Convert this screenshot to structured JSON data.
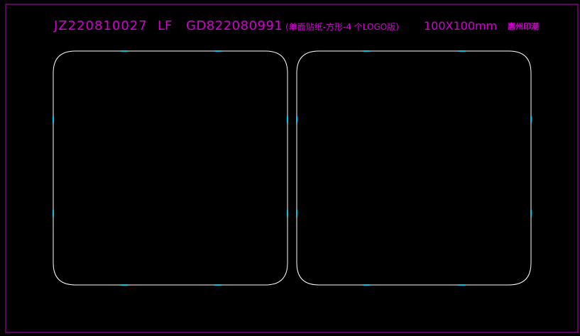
{
  "title": {
    "job_code": "JZ220810027",
    "type_code": "LF",
    "part_code": "GD822080991",
    "description": "(单面贴纸-方形-4 个LOGO版)",
    "size": "100X100mm",
    "company": "惠州印潮"
  },
  "colors": {
    "background": "#000000",
    "frame": "#c000c0",
    "title_text": "#d400d4",
    "outline": "#ffffff",
    "marker": "#00c8e0"
  },
  "panels": [
    {
      "name": "left-label-outline"
    },
    {
      "name": "right-label-outline"
    }
  ]
}
